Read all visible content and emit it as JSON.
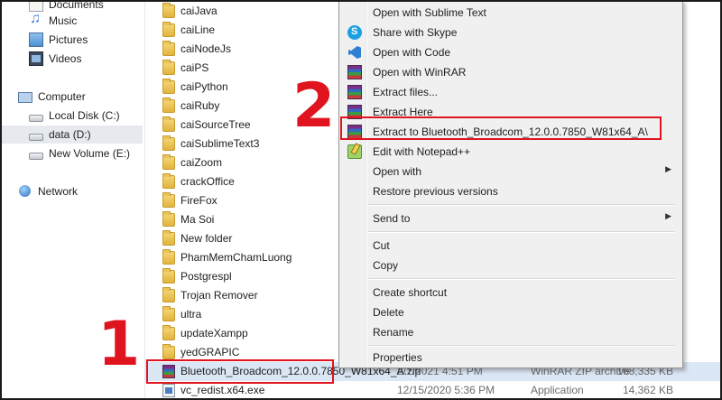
{
  "nav": {
    "items": [
      {
        "label": "Documents",
        "icon": "documents-icon"
      },
      {
        "label": "Music",
        "icon": "music-icon"
      },
      {
        "label": "Pictures",
        "icon": "pictures-icon"
      },
      {
        "label": "Videos",
        "icon": "videos-icon"
      },
      {
        "label": "Computer",
        "icon": "computer-icon"
      },
      {
        "label": "Local Disk (C:)",
        "icon": "disk-icon"
      },
      {
        "label": "data (D:)",
        "icon": "disk-icon"
      },
      {
        "label": "New Volume (E:)",
        "icon": "disk-icon"
      },
      {
        "label": "Network",
        "icon": "network-icon"
      }
    ]
  },
  "files": {
    "folders": [
      "caiJava",
      "caiLine",
      "caiNodeJs",
      "caiPS",
      "caiPython",
      "caiRuby",
      "caiSourceTree",
      "caiSublimeText3",
      "caiZoom",
      "crackOffice",
      "FireFox",
      "Ma Soi",
      "New folder",
      "PhamMemChamLuong",
      "Postgrespl",
      "Trojan Remover",
      "ultra",
      "updateXampp",
      "yedGRAPIC"
    ],
    "selected": {
      "name": "Bluetooth_Broadcom_12.0.0.7850_W81x64_A.zip",
      "date": "2/1/2021 4:51 PM",
      "type": "WinRAR ZIP archive",
      "size": "168,335 KB"
    },
    "last": {
      "name": "vc_redist.x64.exe",
      "date": "12/15/2020 5:36 PM",
      "type": "Application",
      "size": "14,362 KB"
    }
  },
  "menu": {
    "items": [
      {
        "label": "Open with Sublime Text",
        "icon": ""
      },
      {
        "label": "Share with Skype",
        "icon": "skype-icon"
      },
      {
        "label": "Open with Code",
        "icon": "vscode-icon"
      },
      {
        "label": "Open with WinRAR",
        "icon": "winrar-icon"
      },
      {
        "label": "Extract files...",
        "icon": "winrar-icon"
      },
      {
        "label": "Extract Here",
        "icon": "winrar-icon"
      },
      {
        "label": "Extract to Bluetooth_Broadcom_12.0.0.7850_W81x64_A\\",
        "icon": "winrar-icon"
      },
      {
        "label": "Edit with Notepad++",
        "icon": "notepadpp-icon"
      },
      {
        "label": "Open with",
        "icon": ""
      },
      {
        "label": "Restore previous versions",
        "icon": ""
      },
      {
        "label": "Send to",
        "icon": ""
      },
      {
        "label": "Cut",
        "icon": ""
      },
      {
        "label": "Copy",
        "icon": ""
      },
      {
        "label": "Create shortcut",
        "icon": ""
      },
      {
        "label": "Delete",
        "icon": ""
      },
      {
        "label": "Rename",
        "icon": ""
      },
      {
        "label": "Properties",
        "icon": ""
      }
    ],
    "arrow": "▶"
  },
  "steps": {
    "one": "1",
    "two": "2"
  },
  "colors": {
    "highlight": "#e0141e",
    "selection": "#dbe7f5",
    "menu_bg": "#f0f0f0"
  }
}
